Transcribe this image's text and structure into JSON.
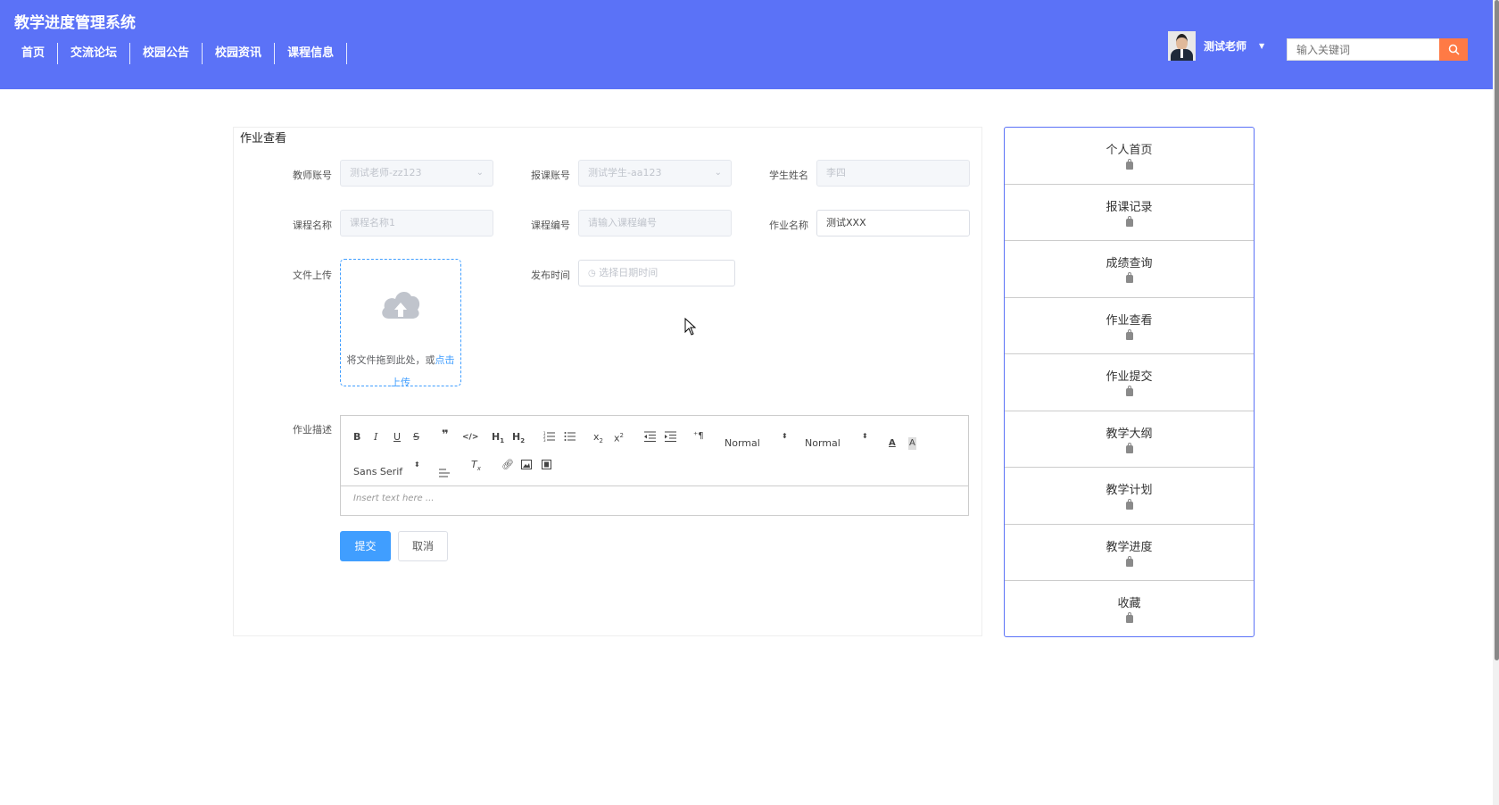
{
  "header": {
    "app_title": "教学进度管理系统",
    "nav": [
      "首页",
      "交流论坛",
      "校园公告",
      "校园资讯",
      "课程信息"
    ],
    "user_name": "测试老师",
    "search_placeholder": "输入关键词"
  },
  "form": {
    "title": "作业查看",
    "fields": {
      "teacher_account": {
        "label": "教师账号",
        "value": "测试老师-zz123"
      },
      "enroll_account": {
        "label": "报课账号",
        "value": "测试学生-aa123"
      },
      "student_name": {
        "label": "学生姓名",
        "value": "李四"
      },
      "course_name": {
        "label": "课程名称",
        "value": "课程名称1"
      },
      "course_code": {
        "label": "课程编号",
        "placeholder": "请输入课程编号"
      },
      "homework_name": {
        "label": "作业名称",
        "value": "测试XXX"
      },
      "file_upload": {
        "label": "文件上传",
        "hint": "将文件拖到此处，或",
        "link": "点击",
        "link2": "上传"
      },
      "publish_time": {
        "label": "发布时间",
        "placeholder": "选择日期时间"
      },
      "description": {
        "label": "作业描述",
        "placeholder": "Insert text here ..."
      }
    },
    "editor_toolbar": {
      "header_select": "Normal",
      "size_select": "Normal",
      "font_select": "Sans Serif"
    },
    "submit_label": "提交",
    "cancel_label": "取消"
  },
  "sidebar": {
    "items": [
      "个人首页",
      "报课记录",
      "成绩查询",
      "作业查看",
      "作业提交",
      "教学大纲",
      "教学计划",
      "教学进度",
      "收藏"
    ]
  },
  "colors": {
    "header_bg": "#5b72f7",
    "primary": "#409eff",
    "search_button": "#ff7a45"
  }
}
